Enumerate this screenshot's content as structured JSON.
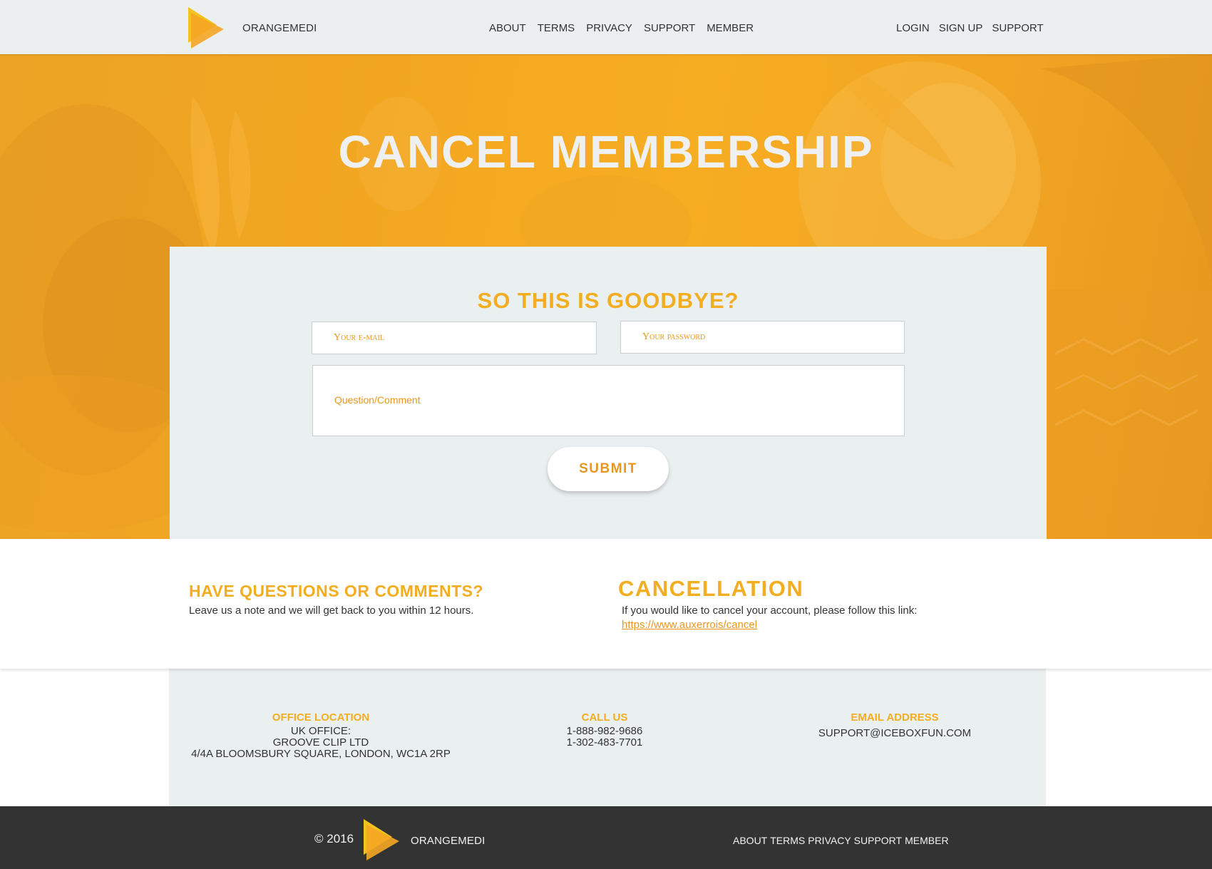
{
  "brand": {
    "name": "ORANGEMEDI",
    "logo_icon": "play-triangle-logo-icon"
  },
  "header": {
    "nav": [
      {
        "label": "ABOUT"
      },
      {
        "label": "TERMS"
      },
      {
        "label": "PRIVACY"
      },
      {
        "label": "SUPPORT"
      },
      {
        "label": "MEMBER"
      }
    ],
    "right_nav": [
      {
        "label": "LOGIN"
      },
      {
        "label": "SIGN UP"
      },
      {
        "label": "SUPPORT"
      }
    ]
  },
  "hero": {
    "title": "CANCEL MEMBERSHIP"
  },
  "form": {
    "title": "SO THIS IS GOODBYE?",
    "email_placeholder": "Your e-mail",
    "password_placeholder": "Your password",
    "comment_placeholder": "Question/Comment",
    "submit_label": "SUBMIT"
  },
  "info": {
    "questions_title": "HAVE QUESTIONS OR COMMENTS?",
    "questions_text": "Leave us a note and we will get back to you within 12 hours.",
    "cancellation_title": "CANCELLATION",
    "cancellation_text": "If you would like to cancel your account, please follow this link:",
    "cancellation_link": "https://www.auxerrois/cancel"
  },
  "contact": {
    "office_title": "OFFICE LOCATION",
    "office_line1": "UK OFFICE:",
    "office_line2": "GROOVE CLIP LTD",
    "office_line3": "4/4A BLOOMSBURY SQUARE, LONDON, WC1A 2RP",
    "call_title": "CALL US",
    "phone1": "1-888-982-9686",
    "phone2": "1-302-483-7701",
    "email_title": "EMAIL ADDRESS",
    "email": "SUPPORT@ICEBOXFUN.COM"
  },
  "footer": {
    "copyright": "© 2016",
    "nav": [
      {
        "label": "ABOUT"
      },
      {
        "label": "TERMS"
      },
      {
        "label": "PRIVACY"
      },
      {
        "label": "SUPPORT"
      },
      {
        "label": "MEMBER"
      }
    ]
  },
  "colors": {
    "accent": "#f3ad21",
    "accent_dark": "#e8961f",
    "header_bg": "#ebeff0",
    "card_bg": "#eaeff0",
    "footer_bg": "#333333"
  }
}
